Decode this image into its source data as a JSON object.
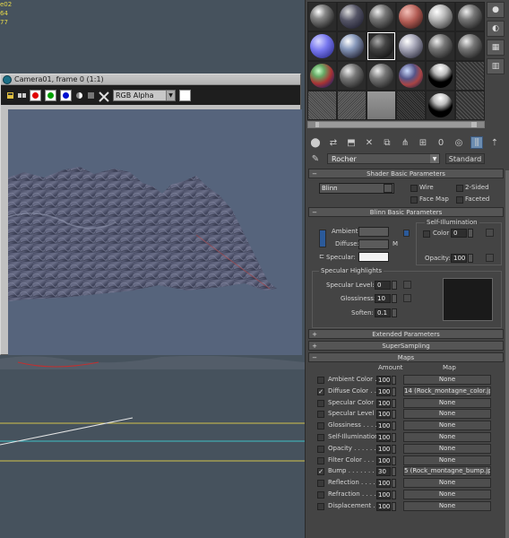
{
  "viewport": {
    "stats": [
      "e02",
      "64",
      "77"
    ]
  },
  "render_window": {
    "title": "Camera01, frame 0 (1:1)",
    "channel": "RGB Alpha",
    "colors": {
      "red": "#e00000",
      "green": "#00a000",
      "blue": "#0010d0"
    }
  },
  "material_editor": {
    "material_name": "Rocher",
    "material_type": "Standard",
    "shader_basic": {
      "header": "Shader Basic Parameters",
      "shader": "Blinn",
      "wire": "Wire",
      "two_sided": "2-Sided",
      "face_map": "Face Map",
      "faceted": "Faceted"
    },
    "blinn_basic": {
      "header": "Blinn Basic Parameters",
      "self_illum_title": "Self-Illumination",
      "color_label": "Color",
      "color_value": "0",
      "ambient_label": "Ambient:",
      "diffuse_label": "Diffuse:",
      "diffuse_map": "M",
      "specular_label": "Specular:",
      "opacity_label": "Opacity:",
      "opacity_value": "100",
      "specular_highlights_title": "Specular Highlights",
      "specular_level_label": "Specular Level:",
      "specular_level_value": "0",
      "glossiness_label": "Glossiness:",
      "glossiness_value": "10",
      "soften_label": "Soften:",
      "soften_value": "0.1"
    },
    "rollouts": {
      "extended": "Extended Parameters",
      "supersampling": "SuperSampling",
      "maps": "Maps"
    },
    "maps": {
      "amount_header": "Amount",
      "map_header": "Map",
      "rows": [
        {
          "label": "Ambient Color . .",
          "amount": "100",
          "map": "None",
          "checked": false
        },
        {
          "label": "Diffuse Color . .",
          "amount": "100",
          "map": "14 (Rock_montagne_color.jpg)",
          "checked": true
        },
        {
          "label": "Specular Color . .",
          "amount": "100",
          "map": "None",
          "checked": false
        },
        {
          "label": "Specular Level . .",
          "amount": "100",
          "map": "None",
          "checked": false
        },
        {
          "label": "Glossiness . . . . .",
          "amount": "100",
          "map": "None",
          "checked": false
        },
        {
          "label": "Self-Illumination .",
          "amount": "100",
          "map": "None",
          "checked": false
        },
        {
          "label": "Opacity . . . . . . .",
          "amount": "100",
          "map": "None",
          "checked": false
        },
        {
          "label": "Filter Color . . . .",
          "amount": "100",
          "map": "None",
          "checked": false
        },
        {
          "label": "Bump . . . . . . . . .",
          "amount": "30",
          "map": "5 (Rock_montagne_bump.jpg)",
          "checked": true
        },
        {
          "label": "Reflection . . . . .",
          "amount": "100",
          "map": "None",
          "checked": false
        },
        {
          "label": "Refraction . . . . .",
          "amount": "100",
          "map": "None",
          "checked": false
        },
        {
          "label": "Displacement . . .",
          "amount": "100",
          "map": "None",
          "checked": false
        }
      ]
    }
  }
}
